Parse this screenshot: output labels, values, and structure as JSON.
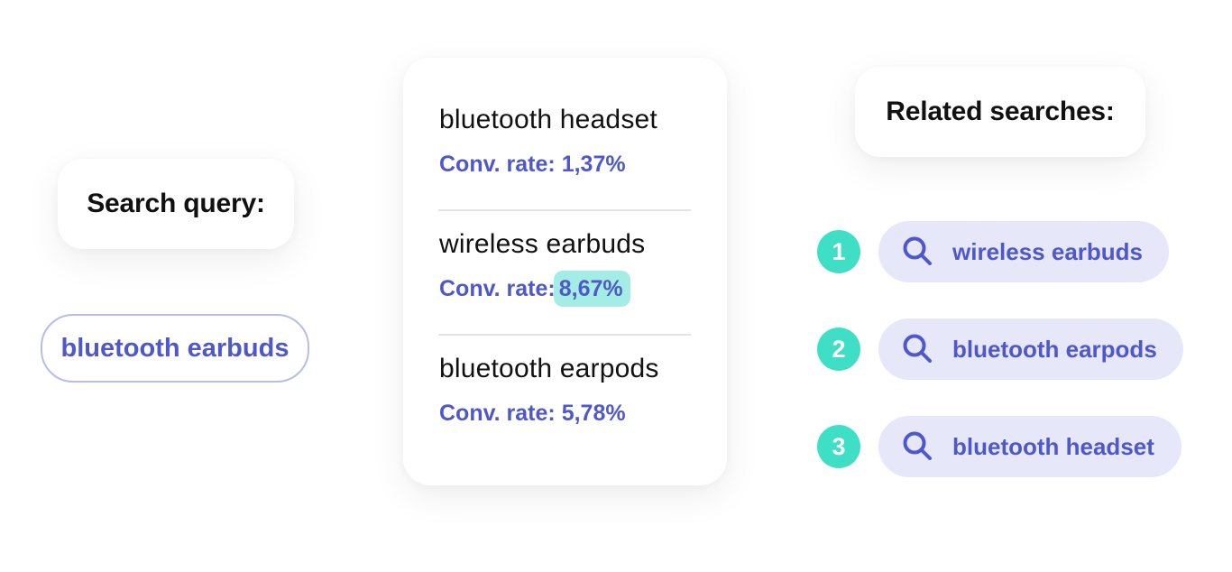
{
  "search_query": {
    "label": "Search query:",
    "value": "bluetooth earbuds"
  },
  "results": [
    {
      "name": "bluetooth headset",
      "rate_label": "Conv. rate:",
      "rate_value": "1,37%",
      "highlighted": false
    },
    {
      "name": "wireless earbuds",
      "rate_label": "Conv. rate:",
      "rate_value": "8,67%",
      "highlighted": true
    },
    {
      "name": "bluetooth earpods",
      "rate_label": "Conv. rate:",
      "rate_value": "5,78%",
      "highlighted": false
    }
  ],
  "related": {
    "label": "Related searches:",
    "items": [
      {
        "rank": "1",
        "icon": "search-icon",
        "text": "wireless earbuds"
      },
      {
        "rank": "2",
        "icon": "search-icon",
        "text": "bluetooth earpods"
      },
      {
        "rank": "3",
        "icon": "search-icon",
        "text": "bluetooth headset"
      }
    ]
  },
  "colors": {
    "accent": "#4f58c9",
    "highlight": "#a3ede4",
    "badge": "#3fdfc6",
    "pill_bg": "#e6e7f9"
  }
}
